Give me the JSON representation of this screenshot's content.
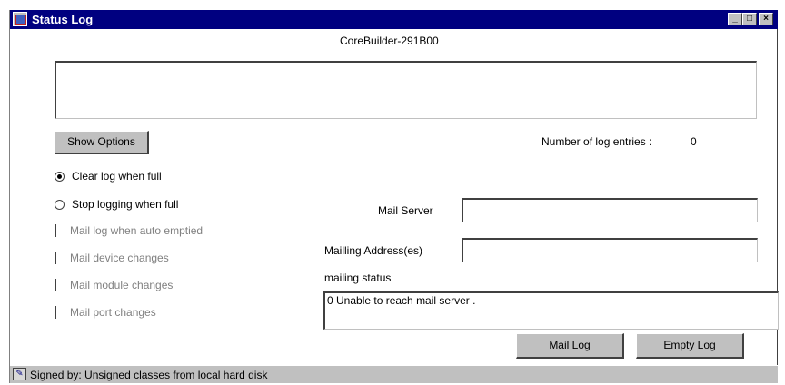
{
  "window": {
    "title": "Status Log",
    "minimize": "_",
    "maximize": "□",
    "close": "×"
  },
  "device": {
    "name": "CoreBuilder-291B00"
  },
  "log": {
    "text": ""
  },
  "options": {
    "show_options_label": "Show Options"
  },
  "entries": {
    "label": "Number of log entries :",
    "count": "0"
  },
  "radios": [
    {
      "label": "Clear log when full",
      "selected": true
    },
    {
      "label": "Stop logging when full",
      "selected": false
    }
  ],
  "checkboxes": [
    {
      "label": "Mail log when auto emptied"
    },
    {
      "label": "Mail device changes"
    },
    {
      "label": "Mail module changes"
    },
    {
      "label": "Mail port changes"
    }
  ],
  "mail": {
    "server_label": "Mail Server",
    "server_value": "",
    "address_label": "Mailling Address(es)",
    "address_value": "",
    "status_label": "mailing status",
    "status_text": "0 Unable to reach mail server ."
  },
  "buttons": {
    "mail_log": "Mail Log",
    "empty_log": "Empty Log"
  },
  "status_bar": {
    "text": "Signed by: Unsigned classes from local hard disk"
  }
}
